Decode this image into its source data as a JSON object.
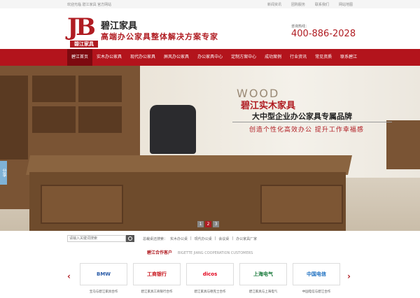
{
  "topbar": {
    "welcome": "欢迎光临 碧江家具 官方网站",
    "quick_links": [
      "新闻资讯",
      "团购服务",
      "联系我们",
      "网站地图"
    ]
  },
  "header": {
    "logo_letters": "JB",
    "logo_badge": "碧江家具",
    "brand_name": "碧江家具",
    "slogan": "高端办公家具整体解决方案专家",
    "hotline_label": "咨询热线：",
    "hotline": "400-886-2028"
  },
  "nav": {
    "items": [
      "碧江首页",
      "实木办公家具",
      "现代办公家具",
      "屏风办公家具",
      "办公家具中心",
      "定制方案中心",
      "成功案例",
      "行业资讯",
      "常见资质",
      "联系碧江"
    ],
    "active_index": 0
  },
  "hero": {
    "wood_word": "WOOD",
    "brand_solid": "碧江实木家具",
    "tagline1": "大中型企业办公家具专属品牌",
    "tagline2": "创造个性化高效办公 提升工作幸福感",
    "side_tab": "分享",
    "slides": [
      "1",
      "2",
      "3"
    ],
    "active_slide": 1
  },
  "search": {
    "placeholder": "请输入关键词搜索",
    "hot_label": "总裁桌还搜索：",
    "hot_words": [
      "实木办公桌",
      "现代办公桌",
      "会议桌",
      "办公家具厂家"
    ]
  },
  "partners": {
    "title_cn": "碧江合作客户",
    "title_en": "BIGETTE JIANG COOPERATION CUSTOMERS",
    "prev": "‹",
    "next": "›",
    "cards": [
      {
        "logo": "BMW",
        "caption": "宝马与碧江家具合作",
        "color": "#2b5ca8"
      },
      {
        "logo": "工商银行",
        "caption": "碧江家具工商银行合作",
        "color": "#c8161d"
      },
      {
        "logo": "dicos",
        "caption": "碧江家具与德克士合作",
        "color": "#e2001a"
      },
      {
        "logo": "上海电气",
        "caption": "碧江家具与上海电气",
        "color": "#1a7a3c"
      },
      {
        "logo": "中国电信",
        "caption": "中国电信与碧江合作",
        "color": "#1c6fc0"
      }
    ]
  }
}
